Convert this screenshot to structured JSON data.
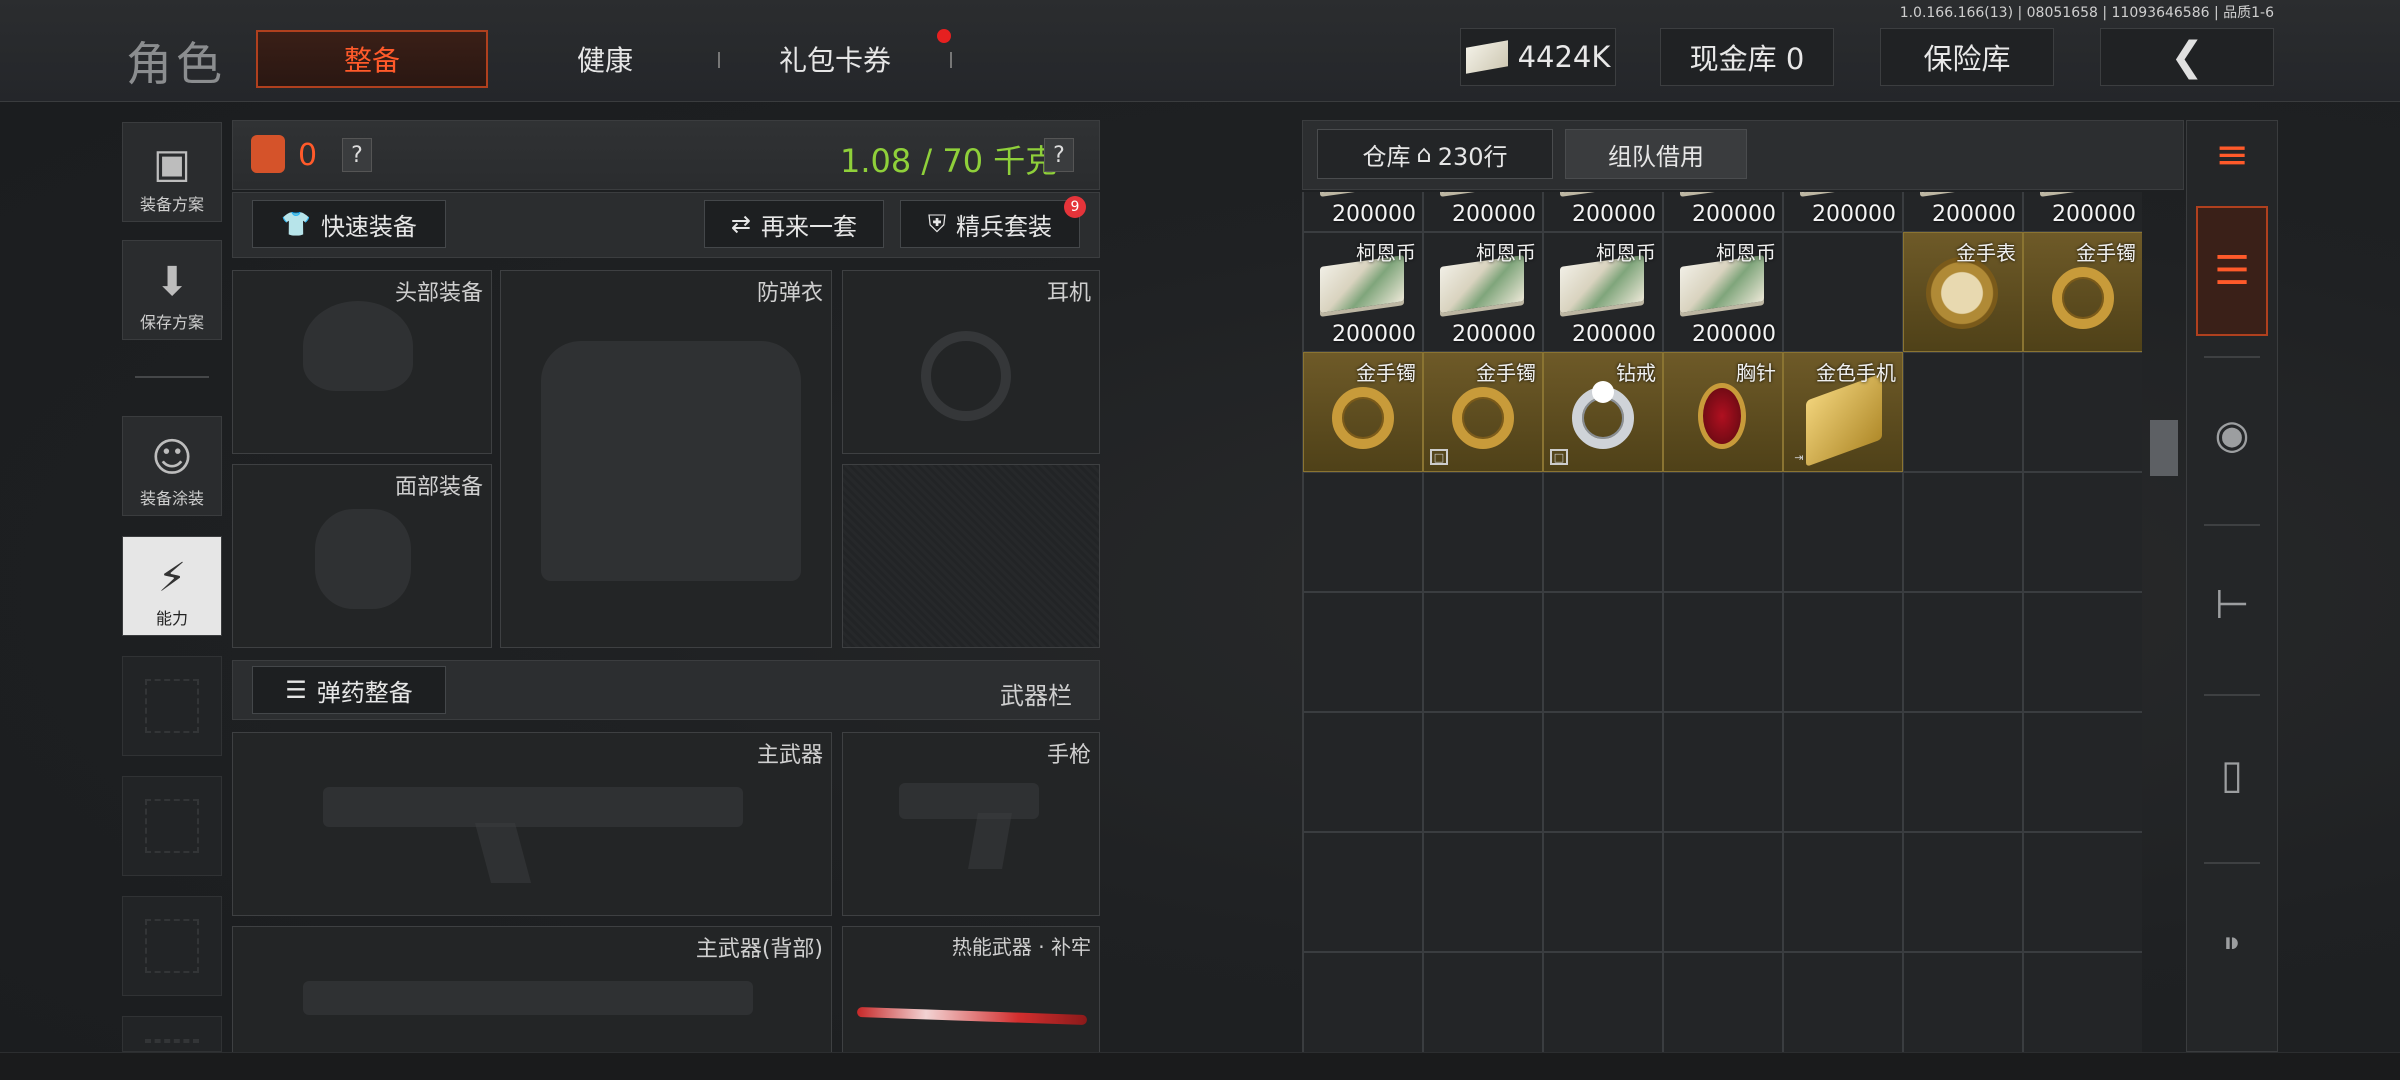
{
  "header": {
    "version": "1.0.166.166(13) | 08051658 | 11093646586 | 品质1-6",
    "title": "角色",
    "tabs": [
      {
        "label": "整备",
        "active": true
      },
      {
        "label": "健康",
        "active": false
      },
      {
        "label": "礼包卡券",
        "active": false,
        "has_notification": true
      }
    ],
    "money": "4424K",
    "cash_vault": "现金库 0",
    "insurance": "保险库",
    "back_icon": "chevron-left-icon"
  },
  "sidebar": {
    "items": [
      {
        "label": "装备方案",
        "icon": "vest-icon"
      },
      {
        "label": "保存方案",
        "icon": "download-icon"
      },
      {
        "label": "装备涂装",
        "icon": "helmet-icon"
      },
      {
        "label": "能力",
        "icon": "lightning-hex-icon",
        "active": true
      }
    ]
  },
  "equip": {
    "bag_count": "0",
    "help": "?",
    "weight": "1.08 / 70 千克",
    "quick_equip": "快速装备",
    "again": "再来一套",
    "elite_set": "精兵套装",
    "elite_badge": "9",
    "slots": {
      "head": "头部装备",
      "armor": "防弹衣",
      "earphone": "耳机",
      "face": "面部装备",
      "primary": "主武器",
      "pistol": "手枪",
      "primary_back": "主武器(背部)",
      "melee": "热能武器 · 补牢"
    },
    "ammo": "弹药整备",
    "weapon_bar": "武器栏"
  },
  "storage": {
    "tab_warehouse": "仓库",
    "rows": "230行",
    "tab_team": "组队借用",
    "top_row_values": [
      "200000",
      "200000",
      "200000",
      "200000",
      "200000",
      "200000",
      "200000"
    ],
    "row2": [
      {
        "name": "柯恩币",
        "value": "200000",
        "kind": "cash"
      },
      {
        "name": "柯恩币",
        "value": "200000",
        "kind": "cash"
      },
      {
        "name": "柯恩币",
        "value": "200000",
        "kind": "cash"
      },
      {
        "name": "柯恩币",
        "value": "200000",
        "kind": "cash"
      },
      {
        "name": "",
        "value": "",
        "kind": "empty"
      },
      {
        "name": "金手表",
        "value": "",
        "kind": "watch"
      },
      {
        "name": "金手镯",
        "value": "",
        "kind": "ring"
      }
    ],
    "row3": [
      {
        "name": "金手镯",
        "kind": "ring"
      },
      {
        "name": "金手镯",
        "kind": "ring"
      },
      {
        "name": "钻戒",
        "kind": "diamond"
      },
      {
        "name": "胸针",
        "kind": "brooch"
      },
      {
        "name": "金色手机",
        "kind": "phone"
      }
    ]
  },
  "right_column": {
    "icons": [
      "sort-refresh-icon",
      "stack-icon",
      "helmet-icon",
      "rifle-icon",
      "magazine-icon",
      "bullet-icon"
    ]
  },
  "colors": {
    "accent": "#ff5a2a",
    "weight_green": "#8fd03a",
    "gold_cell": "#6e5a28"
  }
}
